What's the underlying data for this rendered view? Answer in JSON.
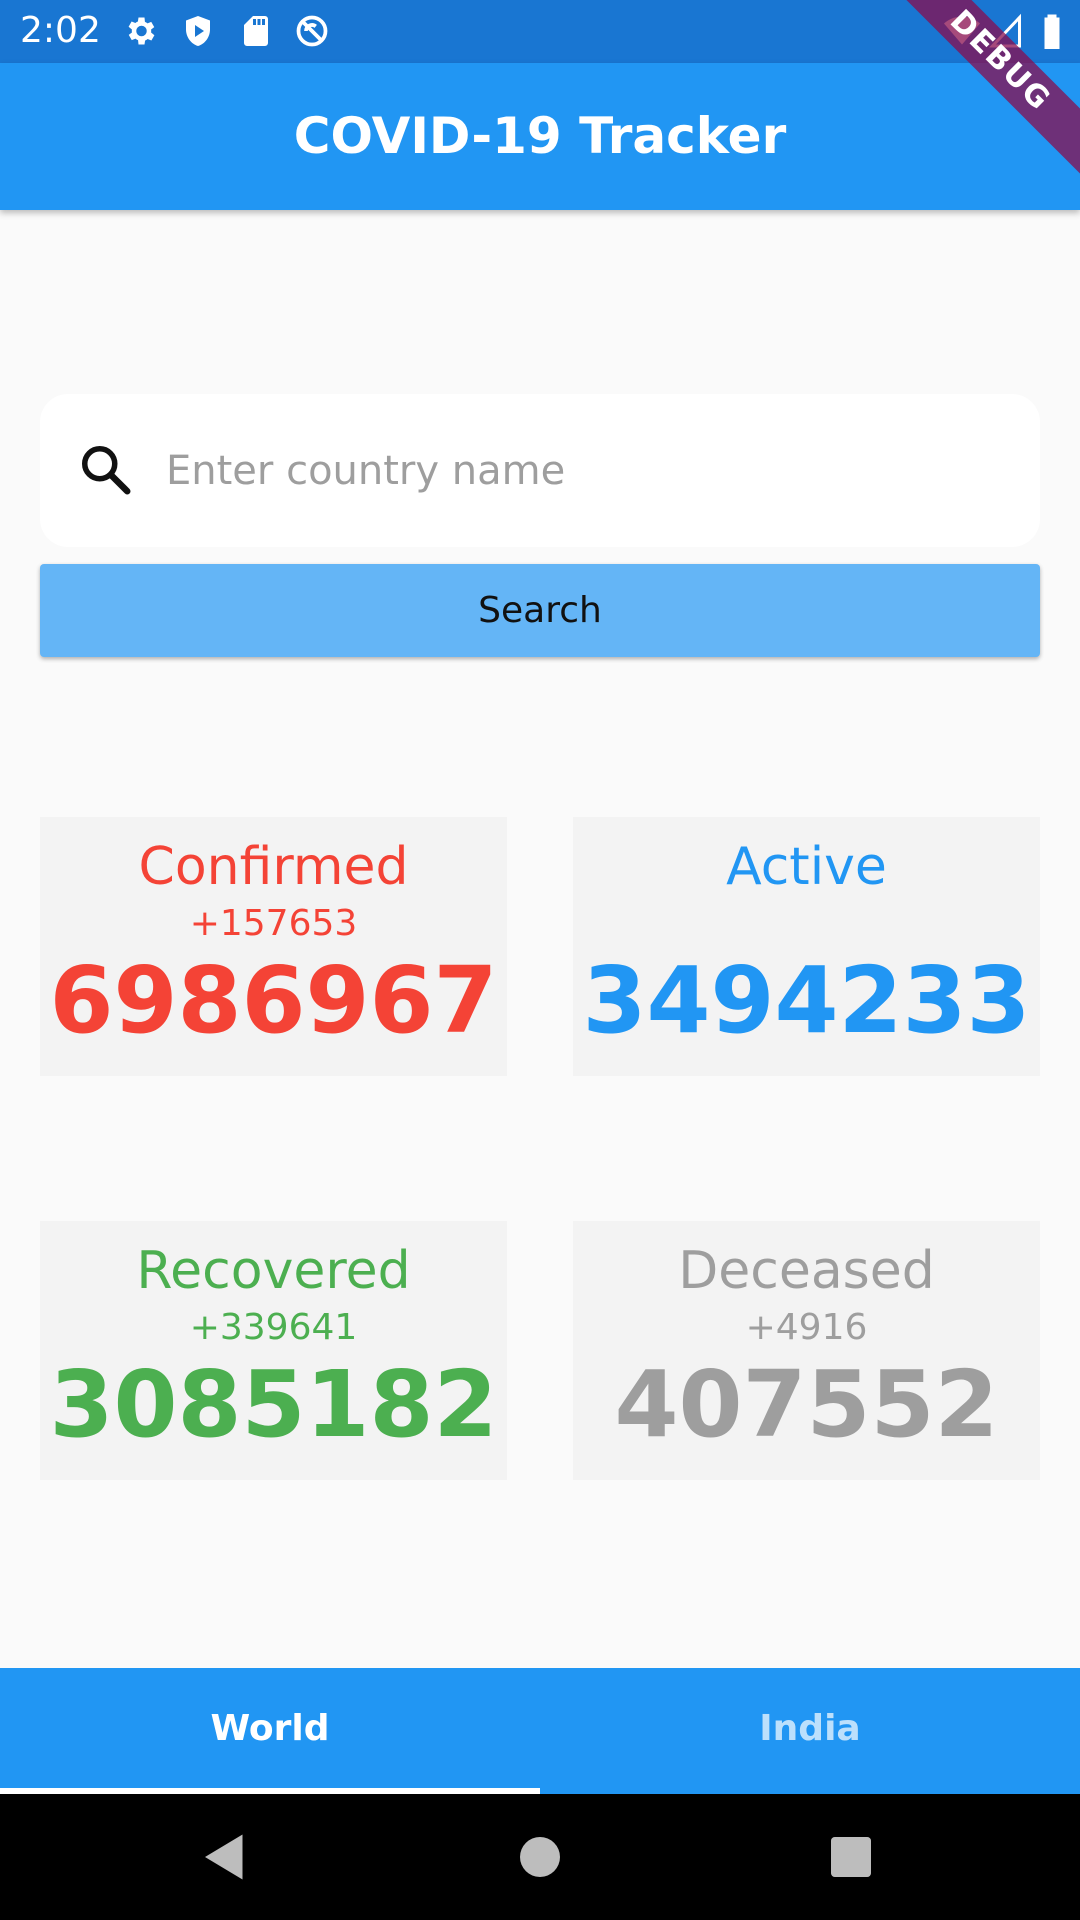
{
  "status_bar": {
    "time": "2:02",
    "icons": [
      "gear-icon",
      "shield-play-icon",
      "sd-card-icon",
      "do-not-disturb-icon",
      "wifi-icon",
      "signal-icon",
      "battery-icon"
    ]
  },
  "app_bar": {
    "title": "COVID-19 Tracker",
    "debug_banner": "DEBUG"
  },
  "search": {
    "placeholder": "Enter country name",
    "value": "",
    "button_label": "Search"
  },
  "stats": {
    "confirmed": {
      "label": "Confirmed",
      "delta": "+157653",
      "value": "6986967",
      "color": "#f44336"
    },
    "active": {
      "label": "Active",
      "delta": "",
      "value": "3494233",
      "color": "#2196f3"
    },
    "recovered": {
      "label": "Recovered",
      "delta": "+339641",
      "value": "3085182",
      "color": "#4caf50"
    },
    "deceased": {
      "label": "Deceased",
      "delta": "+4916",
      "value": "407552",
      "color": "#9e9e9e"
    }
  },
  "tabs": [
    {
      "label": "World",
      "selected": true
    },
    {
      "label": "India",
      "selected": false
    }
  ],
  "colors": {
    "primary": "#2196f3",
    "primary_dark": "#1976d2",
    "button": "#64b5f6"
  }
}
